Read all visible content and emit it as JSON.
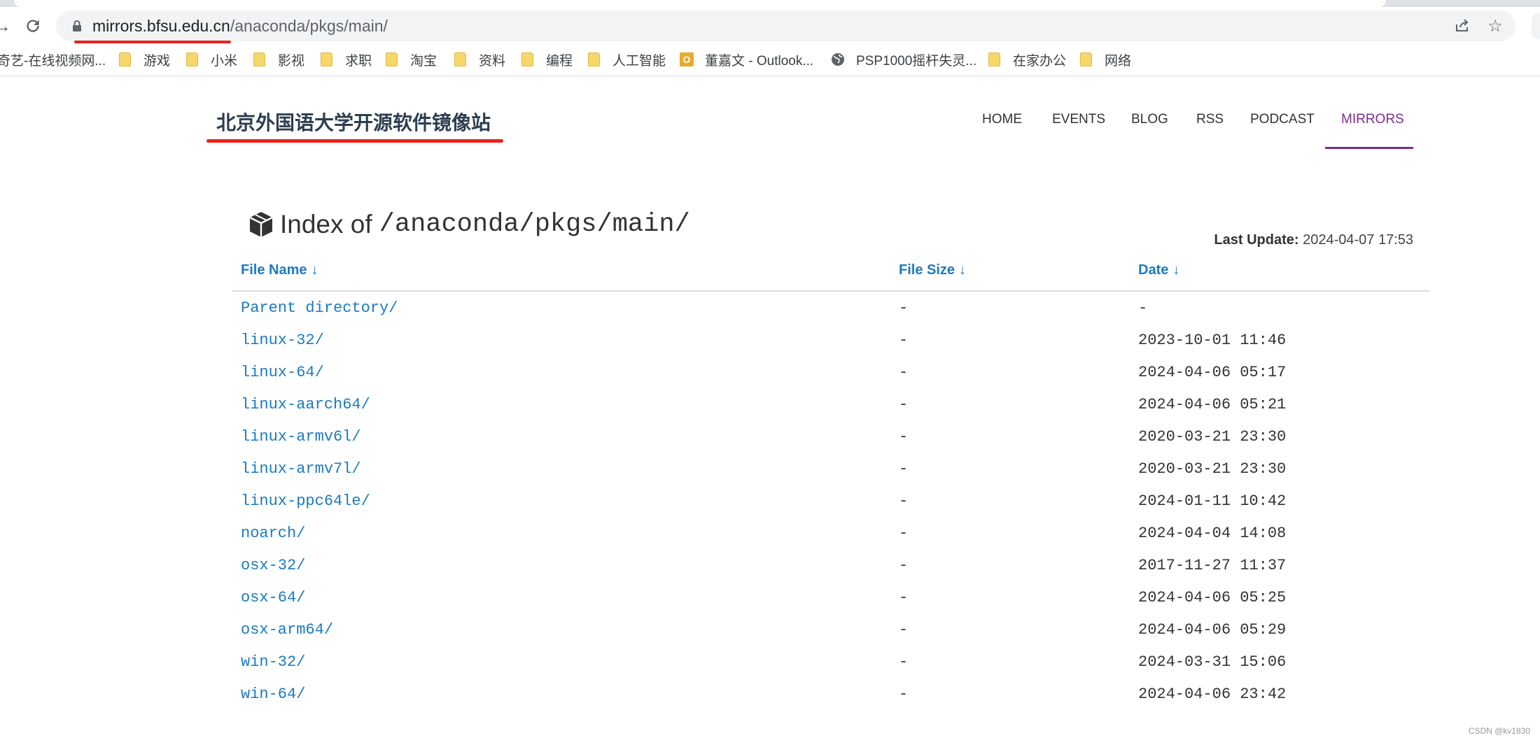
{
  "browser": {
    "url_host": "mirrors.bfsu.edu.cn",
    "url_path": "/anaconda/pkgs/main/",
    "bookmarks": [
      {
        "label": "奇艺-在线视频网...",
        "icon": "partial-icon"
      },
      {
        "label": "游戏",
        "icon": "folder-icon"
      },
      {
        "label": "小米",
        "icon": "folder-icon"
      },
      {
        "label": "影视",
        "icon": "folder-icon"
      },
      {
        "label": "求职",
        "icon": "folder-icon"
      },
      {
        "label": "淘宝",
        "icon": "folder-icon"
      },
      {
        "label": "资料",
        "icon": "folder-icon"
      },
      {
        "label": "编程",
        "icon": "folder-icon"
      },
      {
        "label": "人工智能",
        "icon": "folder-icon"
      },
      {
        "label": "董嘉文 - Outlook...",
        "icon": "outlook-icon"
      },
      {
        "label": "PSP1000摇杆失灵...",
        "icon": "globe-icon"
      },
      {
        "label": "在家办公",
        "icon": "folder-icon"
      },
      {
        "label": "网络",
        "icon": "folder-icon"
      }
    ]
  },
  "site": {
    "title": "北京外国语大学开源软件镜像站",
    "nav": [
      {
        "label": "HOME",
        "active": false
      },
      {
        "label": "EVENTS",
        "active": false
      },
      {
        "label": "BLOG",
        "active": false
      },
      {
        "label": "RSS",
        "active": false
      },
      {
        "label": "PODCAST",
        "active": false
      },
      {
        "label": "MIRRORS",
        "active": true
      }
    ],
    "accent_color": "#7b2d8e",
    "link_color": "#1b7ac0"
  },
  "index": {
    "heading_label": "Index of",
    "heading_path": "/anaconda/pkgs/main/",
    "last_update_label": "Last Update:",
    "last_update_value": "2024-04-07 17:53",
    "columns": {
      "name": "File Name",
      "size": "File Size",
      "date": "Date",
      "sort_arrow": "↓"
    },
    "rows": [
      {
        "name": "Parent directory/",
        "size": "-",
        "date": "-"
      },
      {
        "name": "linux-32/",
        "size": "-",
        "date": "2023-10-01 11:46"
      },
      {
        "name": "linux-64/",
        "size": "-",
        "date": "2024-04-06 05:17"
      },
      {
        "name": "linux-aarch64/",
        "size": "-",
        "date": "2024-04-06 05:21"
      },
      {
        "name": "linux-armv6l/",
        "size": "-",
        "date": "2020-03-21 23:30"
      },
      {
        "name": "linux-armv7l/",
        "size": "-",
        "date": "2020-03-21 23:30"
      },
      {
        "name": "linux-ppc64le/",
        "size": "-",
        "date": "2024-01-11 10:42"
      },
      {
        "name": "noarch/",
        "size": "-",
        "date": "2024-04-04 14:08"
      },
      {
        "name": "osx-32/",
        "size": "-",
        "date": "2017-11-27 11:37"
      },
      {
        "name": "osx-64/",
        "size": "-",
        "date": "2024-04-06 05:25"
      },
      {
        "name": "osx-arm64/",
        "size": "-",
        "date": "2024-04-06 05:29"
      },
      {
        "name": "win-32/",
        "size": "-",
        "date": "2024-03-31 15:06"
      },
      {
        "name": "win-64/",
        "size": "-",
        "date": "2024-04-06 23:42"
      }
    ]
  },
  "watermark": "CSDN @kv1830"
}
